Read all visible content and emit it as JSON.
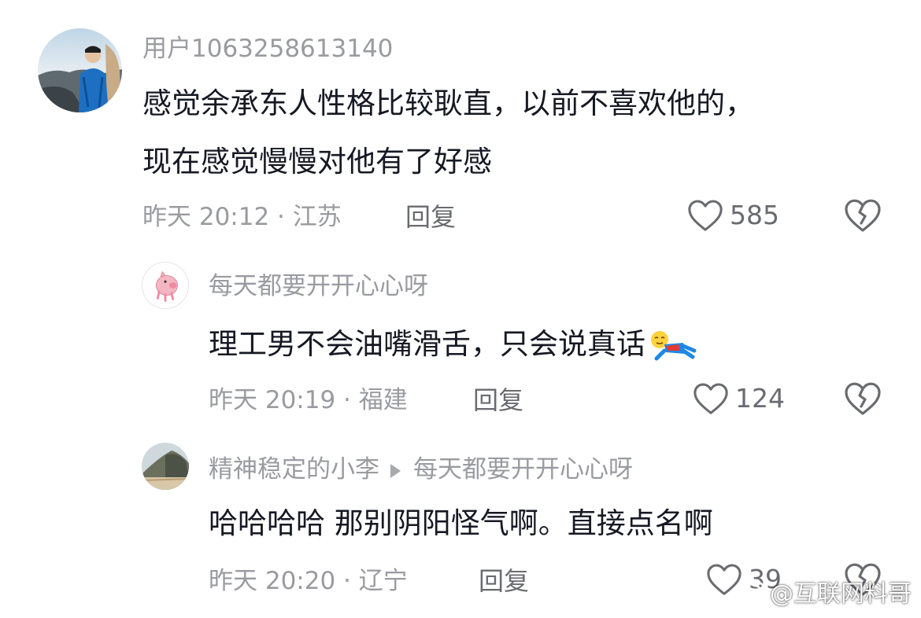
{
  "comments": [
    {
      "username": "用户1063258613140",
      "text_lines": [
        "感觉余承东人性格比较耿直，以前不喜欢他的，",
        "现在感觉慢慢对他有了好感"
      ],
      "meta": "昨天 20:12 · 江苏",
      "reply_label": "回复",
      "likes": "585",
      "avatar_icon": "mountain-portrait-avatar"
    },
    {
      "username": "每天都要开开心心呀",
      "text_lines": [
        "理工男不会油嘴滑舌，只会说真话"
      ],
      "meta": "昨天 20:19 · 福建",
      "reply_label": "回复",
      "likes": "124",
      "avatar_icon": "pink-pig-avatar",
      "emoji": "lying-down-emoji"
    },
    {
      "username": "精神稳定的小李",
      "reply_to": "每天都要开开心心呀",
      "text_lines": [
        "哈哈哈哈 那别阴阳怪气啊。直接点名啊"
      ],
      "meta": "昨天 20:20 · 辽宁",
      "reply_label": "回复",
      "likes": "39",
      "avatar_icon": "rock-landscape-avatar"
    }
  ],
  "watermark": "@互联网料哥",
  "icons": {
    "like": "heart-outline-icon",
    "dislike": "broken-heart-icon",
    "watermark": "weibo-logo-icon"
  },
  "colors": {
    "text": "#161823",
    "muted": "#9a9ba0",
    "reply": "#6a6b70",
    "icon": "#6a6b70"
  }
}
